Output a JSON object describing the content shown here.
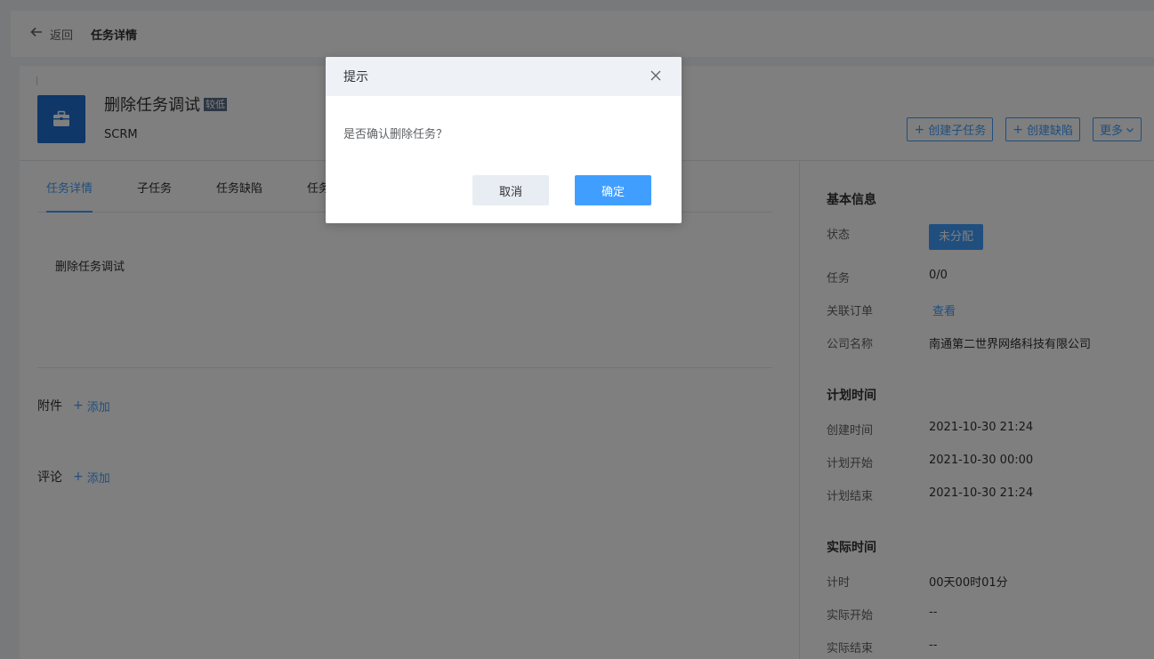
{
  "topbar": {
    "back_label": "返回",
    "title": "任务详情"
  },
  "task": {
    "title": "删除任务调试",
    "priority": "较低",
    "project": "SCRM",
    "icon": "briefcase-icon"
  },
  "actions": {
    "create_subtask": "创建子任务",
    "create_bug": "创建缺陷",
    "more": "更多"
  },
  "tabs": [
    "任务详情",
    "子任务",
    "任务缺陷",
    "任务"
  ],
  "description": "删除任务调试",
  "attachments": {
    "label": "附件",
    "add": "添加"
  },
  "comments": {
    "label": "评论",
    "add": "添加"
  },
  "basic_info": {
    "title": "基本信息",
    "status_label": "状态",
    "status_value": "未分配",
    "task_label": "任务",
    "task_value": "0/0",
    "order_label": "关联订单",
    "order_value": "查看",
    "company_label": "公司名称",
    "company_value": "南通第二世界网络科技有限公司"
  },
  "plan_time": {
    "title": "计划时间",
    "created_label": "创建时间",
    "created_value": "2021-10-30 21:24",
    "start_label": "计划开始",
    "start_value": "2021-10-30 00:00",
    "end_label": "计划结束",
    "end_value": "2021-10-30 21:24"
  },
  "actual_time": {
    "title": "实际时间",
    "timer_label": "计时",
    "timer_value": "00天00时01分",
    "start_label": "实际开始",
    "start_value": "--",
    "end_label": "实际结束",
    "end_value": "--"
  },
  "dialog": {
    "title": "提示",
    "message": "是否确认删除任务？",
    "cancel": "取消",
    "confirm": "确定"
  },
  "colors": {
    "accent": "#409eff",
    "icon_bg": "#1f6fd1",
    "priority_bg": "#5a6d85"
  }
}
